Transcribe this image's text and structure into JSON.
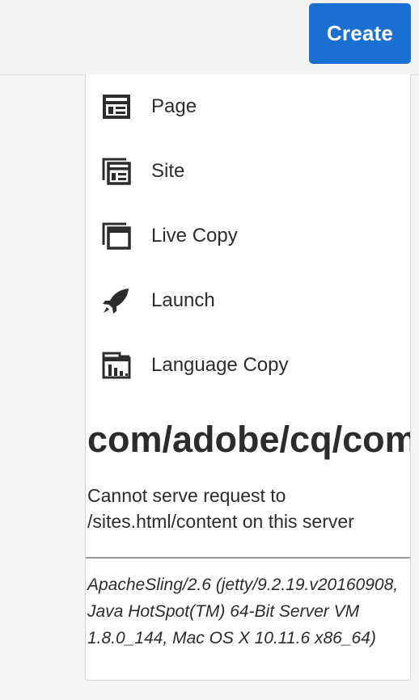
{
  "header": {
    "create_label": "Create"
  },
  "menu": {
    "items": [
      {
        "label": "Page",
        "icon": "page-icon"
      },
      {
        "label": "Site",
        "icon": "site-icon"
      },
      {
        "label": "Live Copy",
        "icon": "live-copy-icon"
      },
      {
        "label": "Launch",
        "icon": "launch-icon"
      },
      {
        "label": "Language Copy",
        "icon": "language-copy-icon"
      }
    ]
  },
  "error": {
    "title": "com/adobe/cq/com",
    "message": "Cannot serve request to /sites.html/content on this server",
    "server_info": "ApacheSling/2.6 (jetty/9.2.19.v20160908, Java HotSpot(TM) 64-Bit Server VM 1.8.0_144, Mac OS X 10.11.6 x86_64)"
  },
  "colors": {
    "accent": "#1a6fd1",
    "background": "#f4f4f4",
    "panel": "#ffffff",
    "text": "#2c2c2c"
  }
}
